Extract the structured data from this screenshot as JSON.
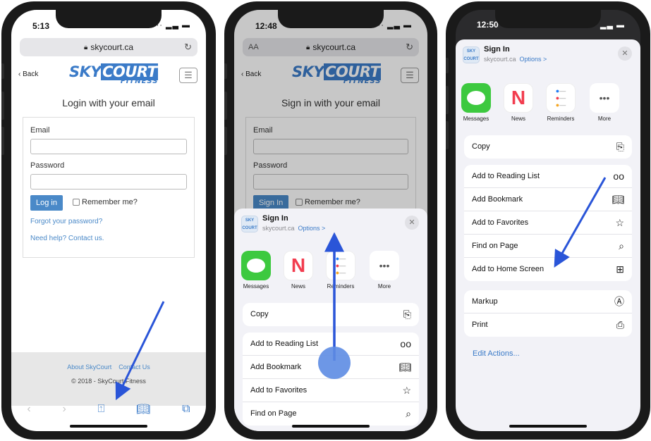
{
  "phone1": {
    "time": "5:13",
    "url": "skycourt.ca",
    "back": "Back",
    "logo_sky": "SKY",
    "logo_court": "COURT",
    "logo_fitness": "FITNESS",
    "heading": "Login with your email",
    "email_label": "Email",
    "password_label": "Password",
    "login_button": "Log in",
    "remember": "Remember me?",
    "forgot": "Forgot your password?",
    "help": "Need help? Contact us.",
    "footer_about": "About SkyCourt",
    "footer_contact": "Contact Us",
    "copyright": "© 2018 - SkyCourt Fitness"
  },
  "phone2": {
    "time": "12:48",
    "aa": "AA",
    "url": "skycourt.ca",
    "back": "Back",
    "heading": "Sign in with your email",
    "email_label": "Email",
    "password_label": "Password",
    "signin_button": "Sign In",
    "remember": "Remember me?",
    "sheet_title": "Sign In",
    "sheet_sub": "skycourt.ca",
    "sheet_options": "Options >",
    "apps": [
      "Messages",
      "News",
      "Reminders",
      "More"
    ],
    "copy": "Copy",
    "actions": [
      "Add to Reading List",
      "Add Bookmark",
      "Add to Favorites",
      "Find on Page"
    ]
  },
  "phone3": {
    "time": "12:50",
    "sheet_title": "Sign In",
    "sheet_sub": "skycourt.ca",
    "sheet_options": "Options >",
    "apps": [
      "Messages",
      "News",
      "Reminders",
      "More"
    ],
    "copy": "Copy",
    "actions": [
      "Add to Reading List",
      "Add Bookmark",
      "Add to Favorites",
      "Find on Page",
      "Add to Home Screen"
    ],
    "more_actions": [
      "Markup",
      "Print"
    ],
    "edit": "Edit Actions..."
  },
  "logo_text": "SKY COURT",
  "colors": {
    "accent": "#3b7bc8",
    "arrow": "#2a55d8",
    "messages": "#3dc93f",
    "news": "#f23d4f"
  },
  "icons": [
    "lock-icon",
    "reload-icon",
    "hamburger-icon",
    "share-icon",
    "bookmarks-icon",
    "tabs-icon",
    "copy-icon",
    "glasses-icon",
    "book-icon",
    "star-icon",
    "search-icon",
    "add-square-icon",
    "markup-icon",
    "print-icon",
    "close-icon"
  ]
}
